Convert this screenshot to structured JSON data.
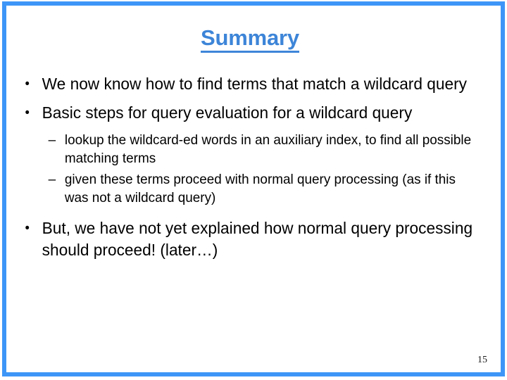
{
  "slide": {
    "title": "Summary",
    "page_number": "15",
    "accent_color": "#3d96f7",
    "title_color": "#3d85d8",
    "text_color": "#000000",
    "background_color": "#ffffff"
  },
  "markers": {
    "level1": "•",
    "level2": "–"
  },
  "bullets": [
    {
      "level": 1,
      "text": "We now know how to find terms that match a wildcard query"
    },
    {
      "level": 1,
      "text": "Basic steps for query evaluation for a wildcard query"
    },
    {
      "level": 2,
      "text": "lookup the wildcard-ed words in an auxiliary index, to find all possible matching terms"
    },
    {
      "level": 2,
      "text": "given these terms proceed with normal query processing (as if this was not a wildcard query)"
    },
    {
      "level": 1,
      "text": "But, we have not yet explained how normal query processing should proceed! (later…)"
    }
  ]
}
